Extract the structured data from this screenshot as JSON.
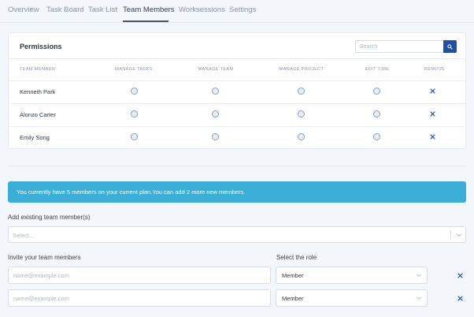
{
  "tabs": [
    {
      "label": "Overview",
      "active": false
    },
    {
      "label": "Task Board",
      "active": false
    },
    {
      "label": "Task List",
      "active": false
    },
    {
      "label": "Team Members",
      "active": true
    },
    {
      "label": "Worksessions",
      "active": false
    },
    {
      "label": "Settings",
      "active": false
    }
  ],
  "permissions": {
    "title": "Permissions",
    "search_placeholder": "Search",
    "columns": [
      "TEAM MEMBER",
      "MANAGE TASKS",
      "MANAGE TEAM",
      "MANAGE PROJECT",
      "EDIT TIME",
      "REMOVE"
    ],
    "rows": [
      {
        "name": "Kenneth Park"
      },
      {
        "name": "Alonzo Carter"
      },
      {
        "name": "Emily Song"
      }
    ]
  },
  "plan_banner": "You currently have 5 members on your current plan.You can add 2 more new members.",
  "add_existing": {
    "label": "Add existing team member(s)",
    "placeholder": "Select..."
  },
  "invite": {
    "label": "Invite your team members",
    "role_label": "Select the role",
    "rows": [
      {
        "email_placeholder": "name@example.com",
        "role": "Member"
      },
      {
        "email_placeholder": "name@example.com",
        "role": "Member"
      }
    ]
  },
  "colors": {
    "accent": "#1f4fa8",
    "banner": "#3aaed6",
    "background": "#f3f6fa"
  }
}
